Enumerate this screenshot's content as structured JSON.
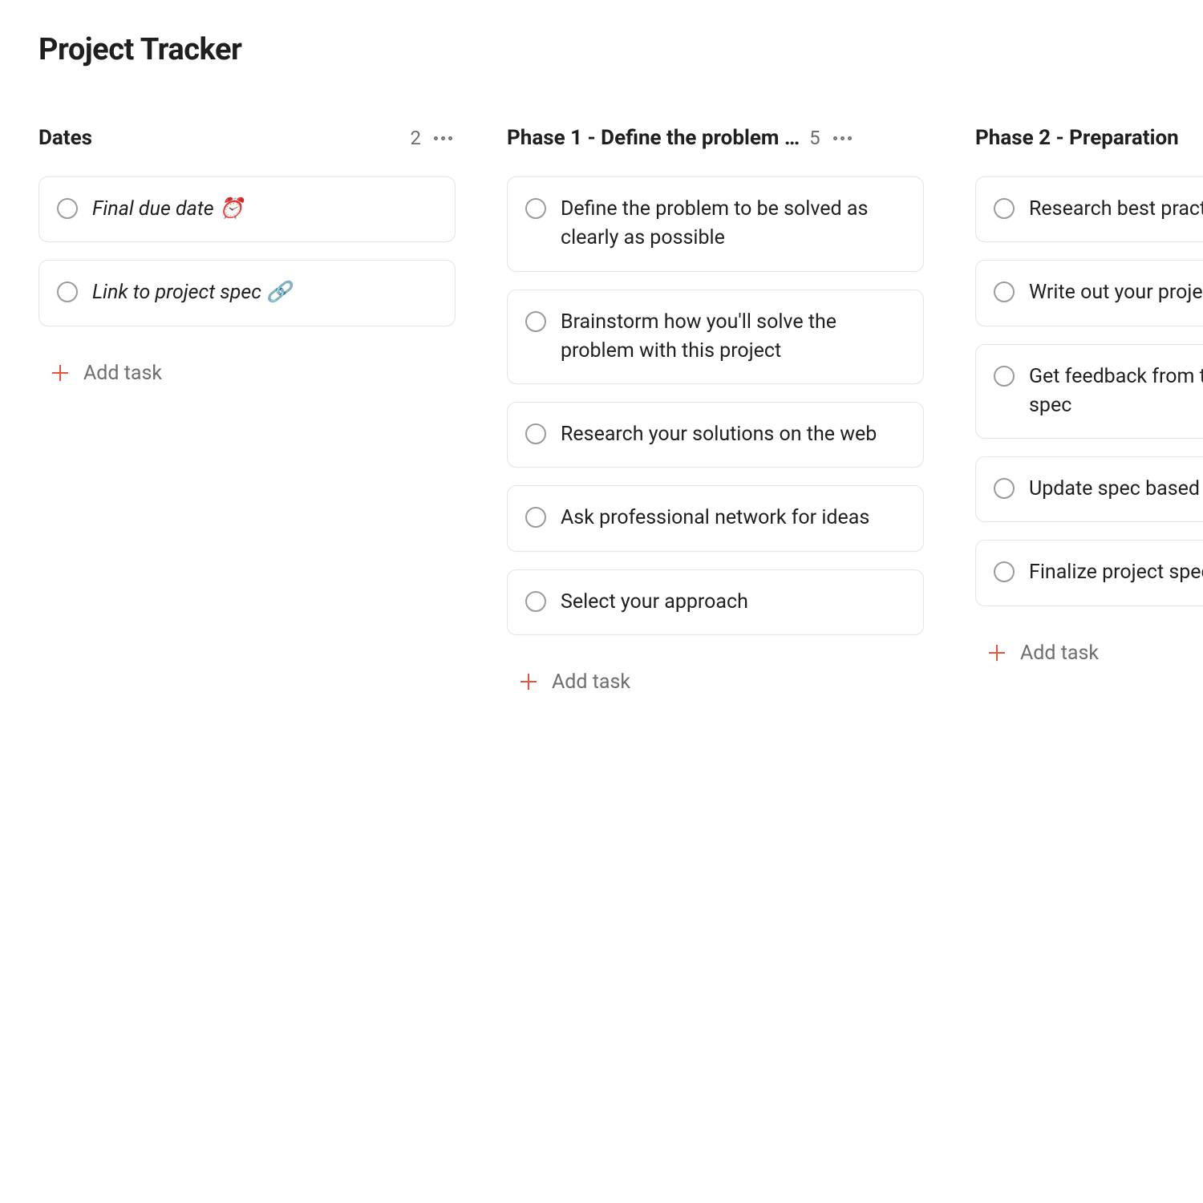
{
  "header": {
    "title": "Project Tracker"
  },
  "add_task_label": "Add task",
  "columns": [
    {
      "title": "Dates",
      "count": "2",
      "tasks": [
        {
          "text": "Final due date ⏰",
          "italic": true
        },
        {
          "text": "Link to project spec 🔗",
          "italic": true
        }
      ]
    },
    {
      "title": "Phase 1 - Define the problem …",
      "count": "5",
      "tasks": [
        {
          "text": "Define the problem to be solved as clearly as possible",
          "italic": false
        },
        {
          "text": "Brainstorm how you'll solve the problem with this project",
          "italic": false
        },
        {
          "text": "Research your solutions on the web",
          "italic": false
        },
        {
          "text": "Ask professional network for ideas",
          "italic": false
        },
        {
          "text": "Select your approach",
          "italic": false
        }
      ]
    },
    {
      "title": "Phase 2 - Preparation",
      "count": "",
      "tasks": [
        {
          "text": "Research best practices for your idea",
          "italic": false
        },
        {
          "text": "Write out your project spec",
          "italic": false
        },
        {
          "text": "Get feedback from team on project spec",
          "italic": false
        },
        {
          "text": "Update spec based on feedback",
          "italic": false
        },
        {
          "text": "Finalize project spec",
          "italic": false
        }
      ]
    }
  ]
}
